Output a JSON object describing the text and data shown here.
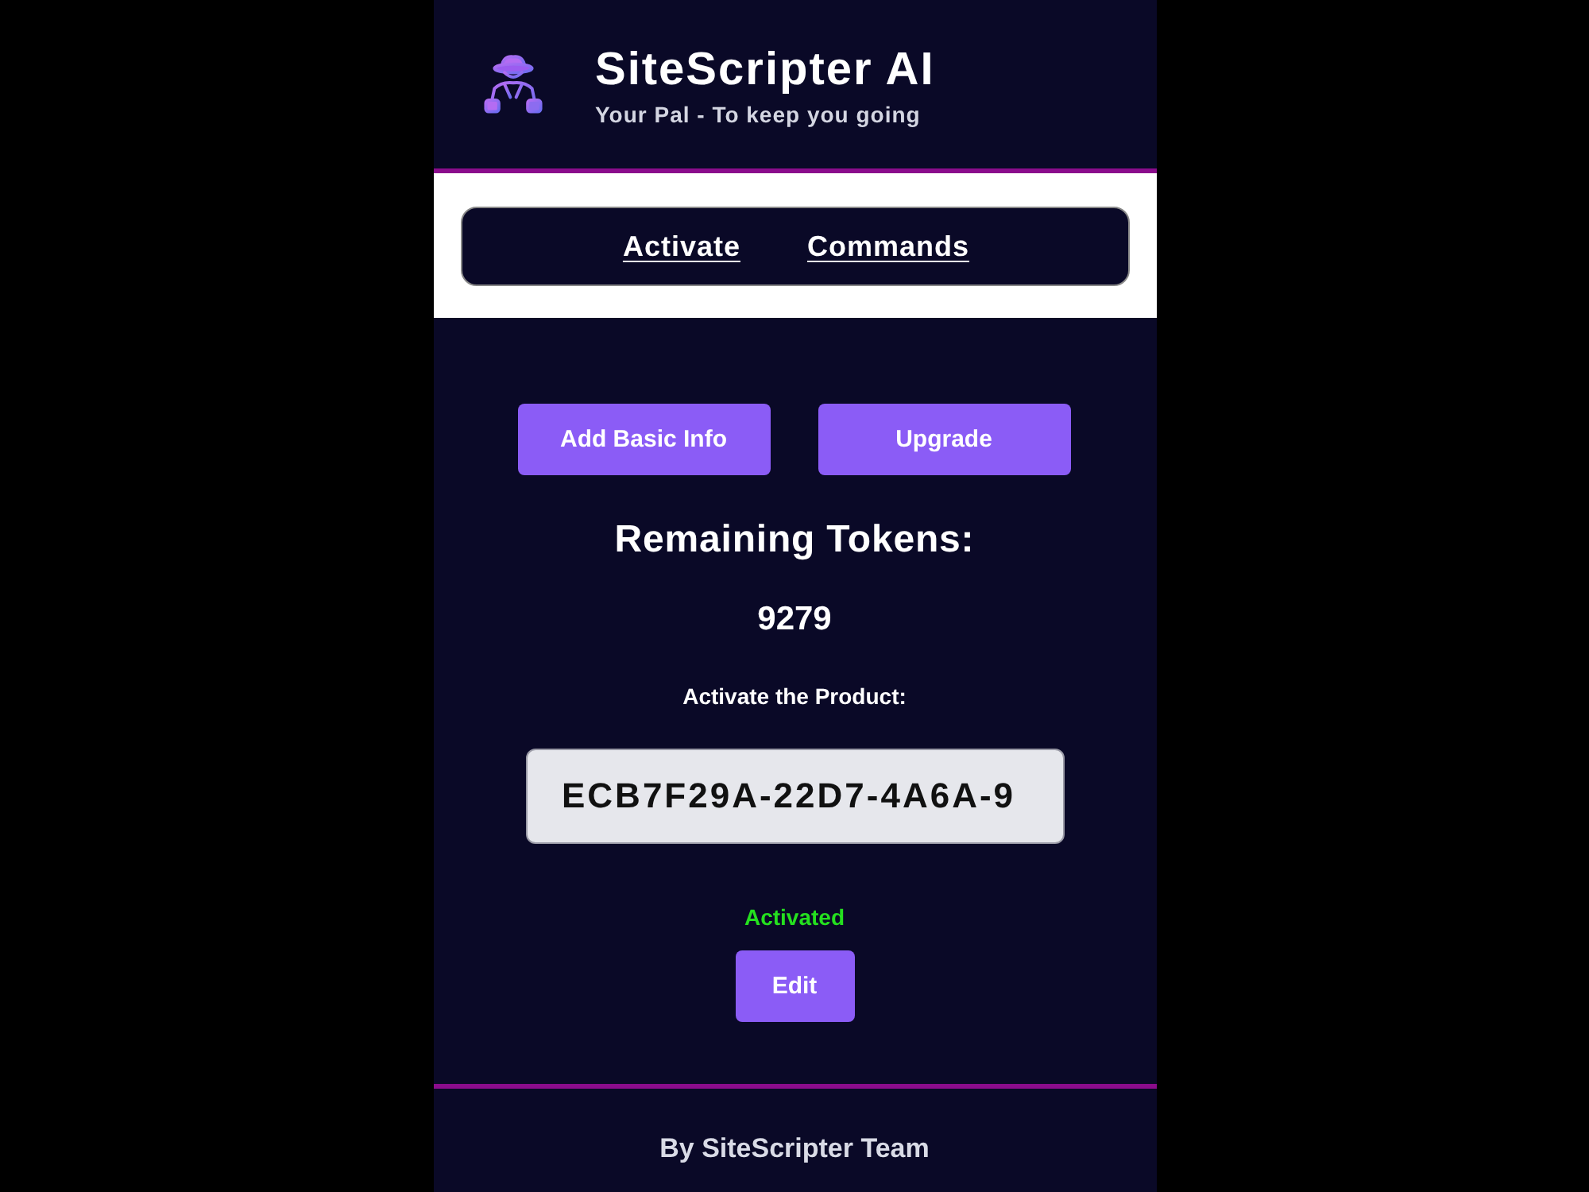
{
  "header": {
    "title": "SiteScripter AI",
    "subtitle": "Your Pal - To keep you going"
  },
  "nav": {
    "links": [
      "Activate",
      "Commands"
    ]
  },
  "actions": [
    "Add Basic Info",
    "Upgrade"
  ],
  "tokens": {
    "label": "Remaining Tokens:",
    "value": "9279"
  },
  "activation": {
    "label": "Activate the Product:",
    "value": "ECB7F29A-22D7-4A6A-9",
    "status": {
      "text": "Activated",
      "kind": "success"
    },
    "button": "Edit"
  },
  "footer": {
    "text": "By SiteScripter Team"
  }
}
